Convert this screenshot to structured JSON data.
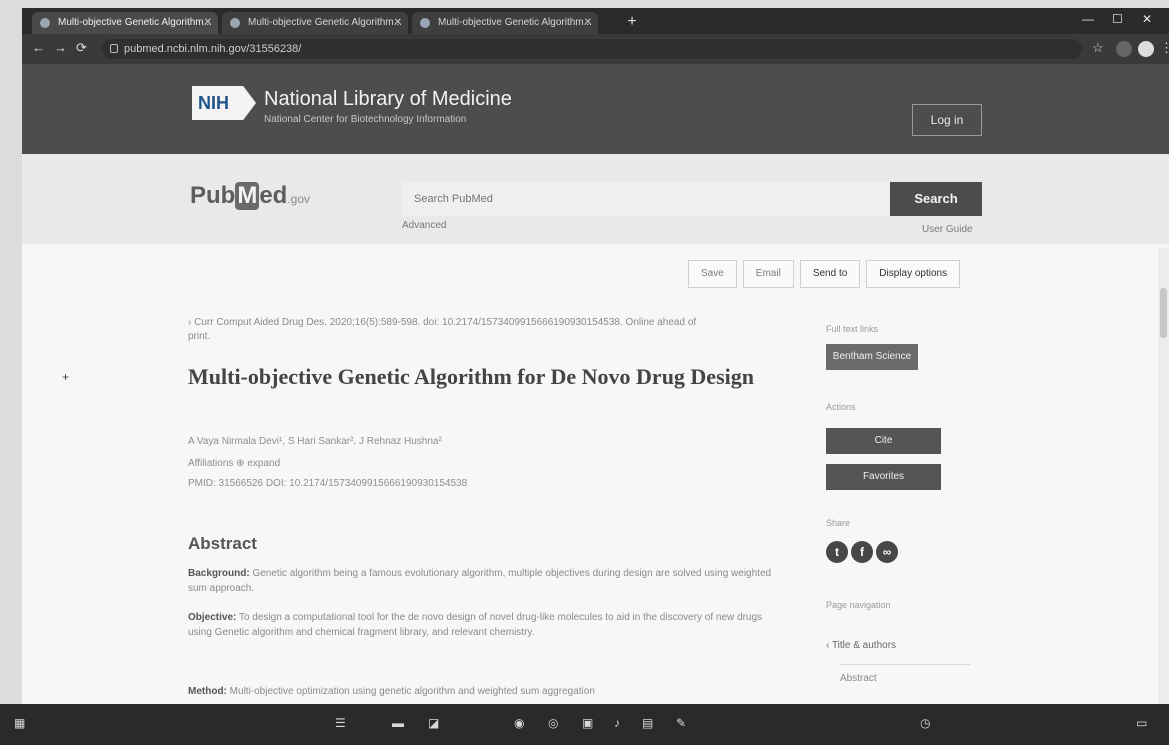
{
  "browser": {
    "tabs": [
      {
        "label": "Multi-objective Genetic Algorithm..."
      },
      {
        "label": "Multi-objective Genetic Algorithm..."
      },
      {
        "label": "Multi-objective Genetic Algorithm..."
      }
    ],
    "new_tab": "+",
    "url": "pubmed.ncbi.nlm.nih.gov/31556238/"
  },
  "nih": {
    "logo": "NIH",
    "title": "National Library of Medicine",
    "subtitle": "National Center for Biotechnology Information",
    "login": "Log in"
  },
  "pubmed": {
    "logo_pub": "Pub",
    "logo_m": "M",
    "logo_ed": "ed",
    "logo_gov": ".gov",
    "search_placeholder": "Search PubMed",
    "search_button": "Search",
    "advanced": "Advanced",
    "user_guide": "User Guide"
  },
  "actions": {
    "save": "Save",
    "email": "Email",
    "send_to": "Send to",
    "display": "Display options"
  },
  "article": {
    "breadcrumb": "› Curr Comput Aided Drug Des. 2020;16(5):589-598. doi: 10.2174/1573409915666190930154538. Online ahead of print.",
    "title": "Multi-objective Genetic Algorithm for De Novo Drug Design",
    "authors": "A Vaya Nirmala Devi¹, S Hari Sankar², J Rehnaz Hushna²",
    "affiliations": "Affiliations  ⊕ expand",
    "ids": "PMID: 31566526   DOI: 10.2174/1573409915666190930154538",
    "abstract_heading": "Abstract",
    "p1_label": "Background:",
    "p1_text": "Genetic algorithm being a famous evolutionary algorithm, multiple objectives during design are solved using weighted sum approach.",
    "p2_label": "Objective:",
    "p2_text": "To design a computational tool for the de novo design of novel drug-like molecules to aid in the discovery of new drugs using Genetic algorithm and chemical fragment library, and relevant chemistry.",
    "p3_label": "Method:",
    "p3_text": "Multi-objective optimization using genetic algorithm and weighted sum aggregation"
  },
  "sidebar": {
    "full_text_label": "Full text links",
    "full_text_button": "Bentham Science",
    "actions_label": "Actions",
    "cite": "Cite",
    "favorites": "Favorites",
    "share_label": "Share",
    "page_nav_label": "Page navigation",
    "toc_title": "Title & authors",
    "toc_abstract": "Abstract"
  },
  "share_icons": [
    {
      "icon": "twitter-icon",
      "glyph": "t"
    },
    {
      "icon": "facebook-icon",
      "glyph": "f"
    },
    {
      "icon": "link-icon",
      "glyph": "∞"
    }
  ]
}
